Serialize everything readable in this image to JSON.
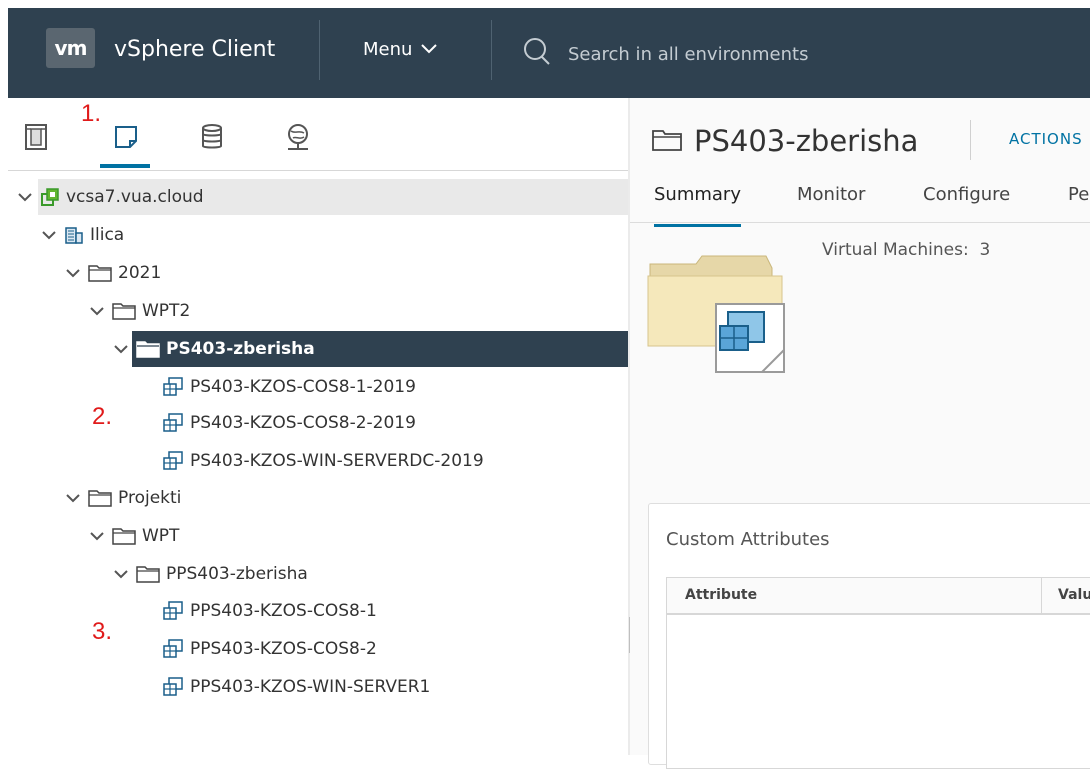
{
  "header": {
    "logo_text": "vm",
    "app_name": "vSphere Client",
    "menu_label": "Menu",
    "search_placeholder": "Search in all environments"
  },
  "annotations": [
    "1.",
    "2.",
    "3."
  ],
  "tree": {
    "root": "vcsa7.vua.cloud",
    "datacenter": "Ilica",
    "folders": {
      "f2021": "2021",
      "wpt2": "WPT2",
      "ps403": "PS403-zberisha",
      "projekti": "Projekti",
      "wpt": "WPT",
      "pps403": "PPS403-zberisha"
    },
    "vms_ps403": [
      "PS403-KZOS-COS8-1-2019",
      "PS403-KZOS-COS8-2-2019",
      "PS403-KZOS-WIN-SERVERDC-2019"
    ],
    "vms_pps403": [
      "PPS403-KZOS-COS8-1",
      "PPS403-KZOS-COS8-2",
      "PPS403-KZOS-WIN-SERVER1"
    ]
  },
  "object": {
    "title": "PS403-zberisha",
    "actions_label": "ACTIONS",
    "tabs": [
      "Summary",
      "Monitor",
      "Configure",
      "Pe"
    ],
    "vm_count_label": "Virtual Machines:",
    "vm_count": "3"
  },
  "custom_attributes": {
    "title": "Custom Attributes",
    "columns": [
      "Attribute",
      "Valu"
    ]
  },
  "colors": {
    "header_bg": "#2f4150",
    "accent": "#0072a3",
    "selected_row": "#2f4150",
    "annotation": "#e01a1a"
  }
}
